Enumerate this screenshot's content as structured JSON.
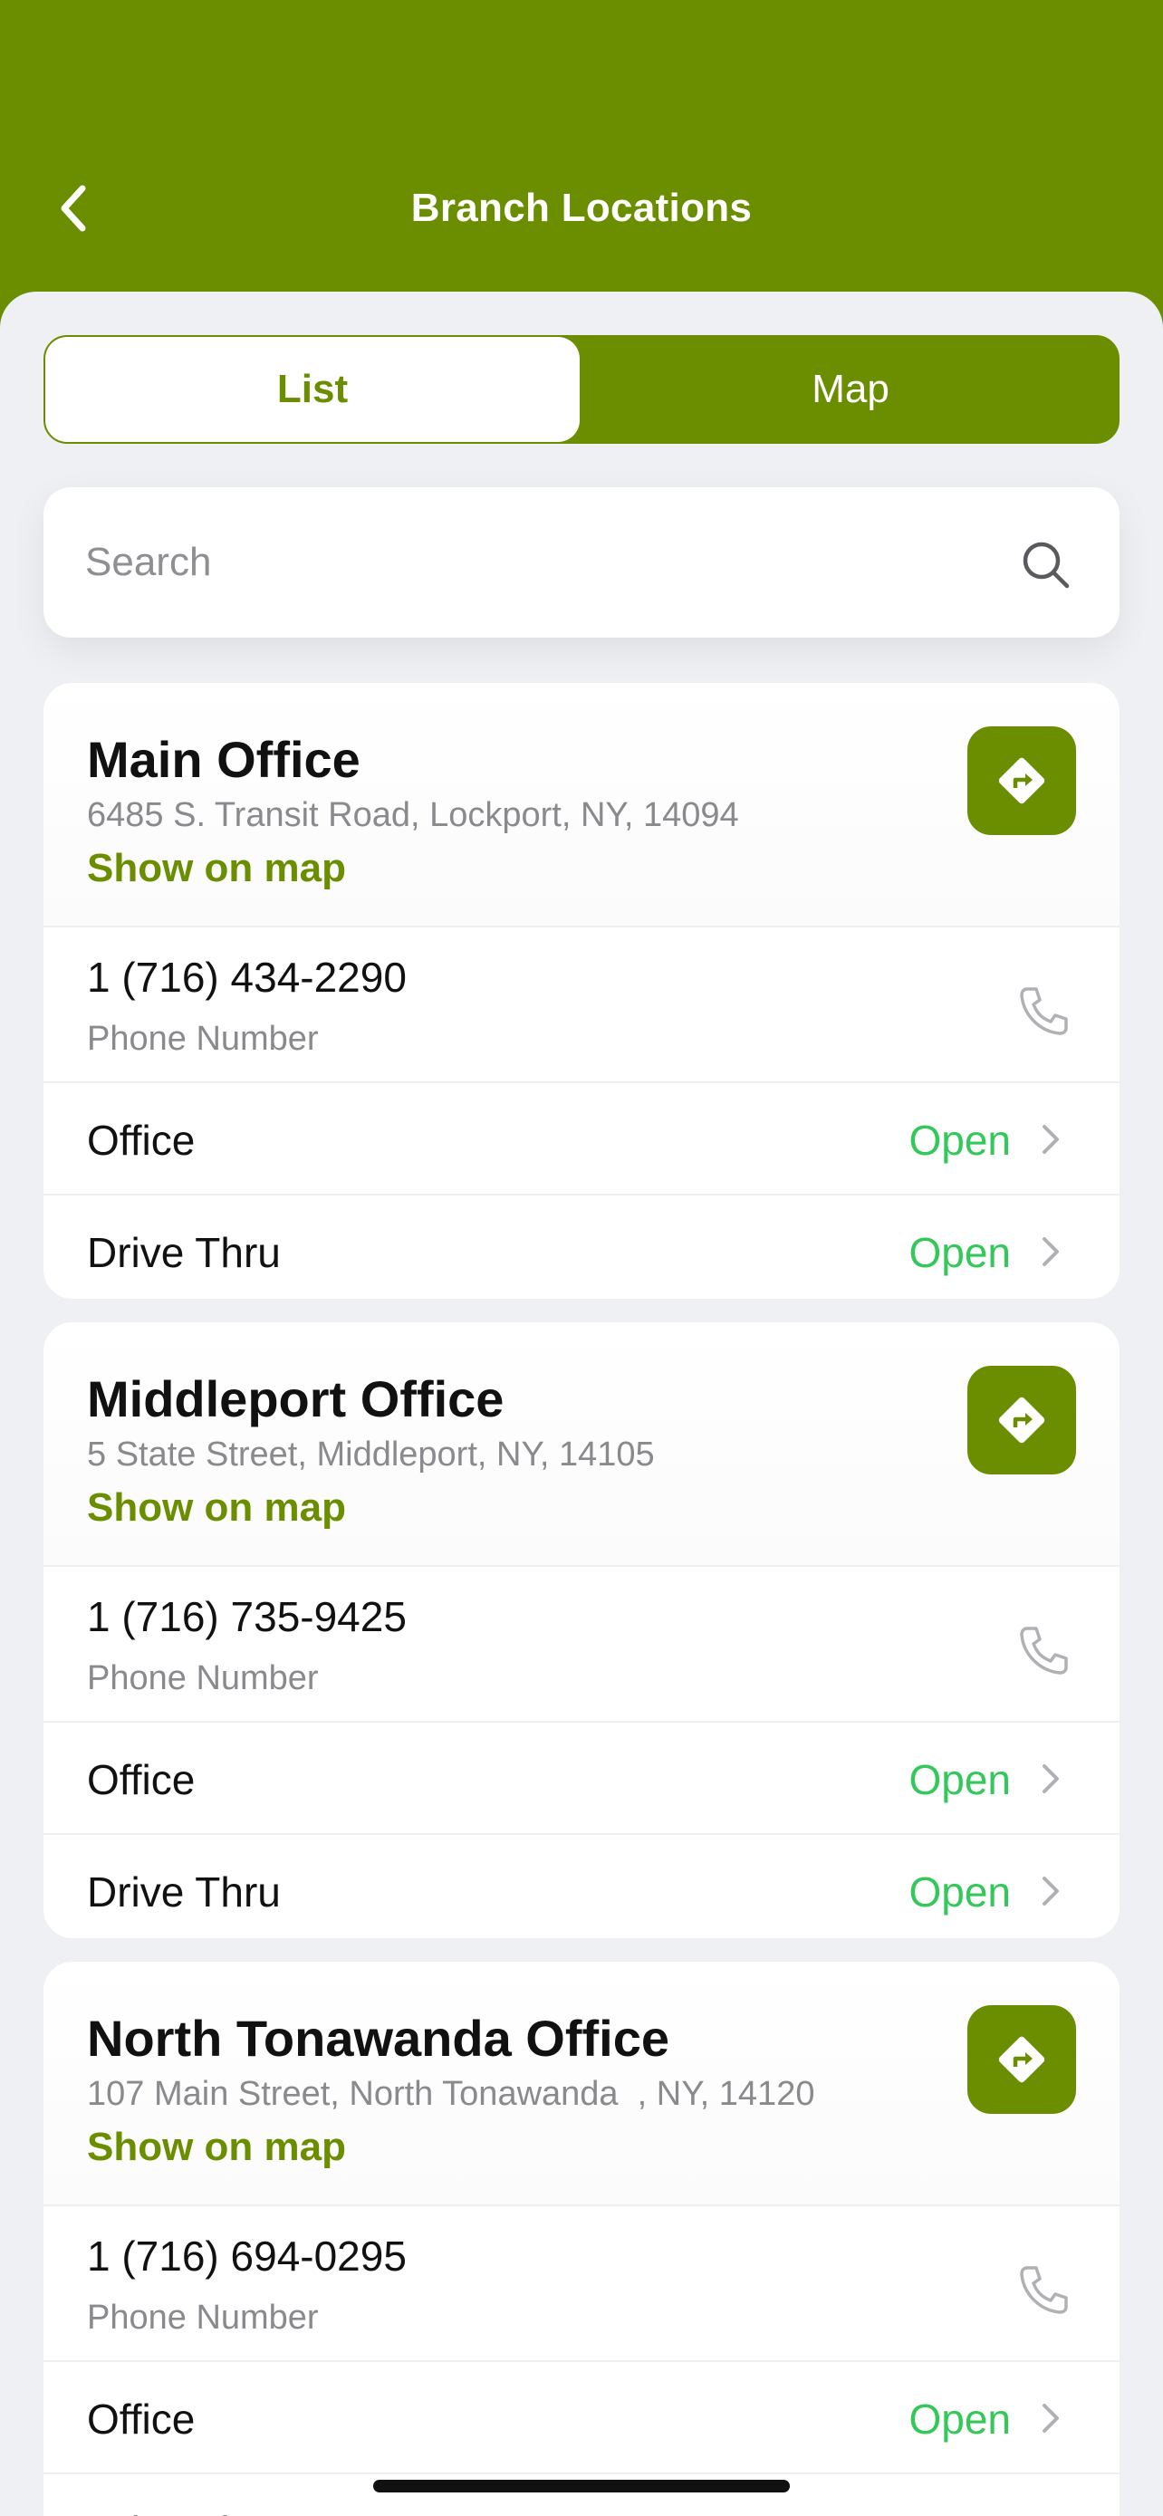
{
  "header": {
    "title": "Branch Locations"
  },
  "segment": {
    "list_label": "List",
    "map_label": "Map",
    "selected": "List"
  },
  "search": {
    "placeholder": "Search",
    "value": ""
  },
  "labels": {
    "show_on_map": "Show on map",
    "phone_label": "Phone Number"
  },
  "branches": [
    {
      "name": "Main Office",
      "address": "6485 S. Transit Road, Lockport, NY, 14094",
      "phone": "1 (716) 434-2290",
      "office_label": "Office",
      "office_status": "Open",
      "drive_label": "Drive Thru",
      "drive_status": "Open"
    },
    {
      "name": "Middleport Office",
      "address": "5 State Street, Middleport, NY, 14105",
      "phone": "1 (716) 735-9425",
      "office_label": "Office",
      "office_status": "Open",
      "drive_label": "Drive Thru",
      "drive_status": "Open"
    },
    {
      "name": "North Tonawanda Office",
      "address": "107 Main Street, North Tonawanda  , NY, 14120",
      "phone": "1 (716) 694-0295",
      "office_label": "Office",
      "office_status": "Open",
      "drive_label": "Drive Thru",
      "drive_status": "Open"
    }
  ],
  "colors": {
    "brand": "#6b8e00",
    "open_status": "#34c759",
    "background": "#eff0f3"
  },
  "icons": {
    "back": "chevron-left-icon",
    "search": "search-icon",
    "directions": "directions-icon",
    "phone": "phone-icon",
    "row": "chevron-right-icon"
  }
}
